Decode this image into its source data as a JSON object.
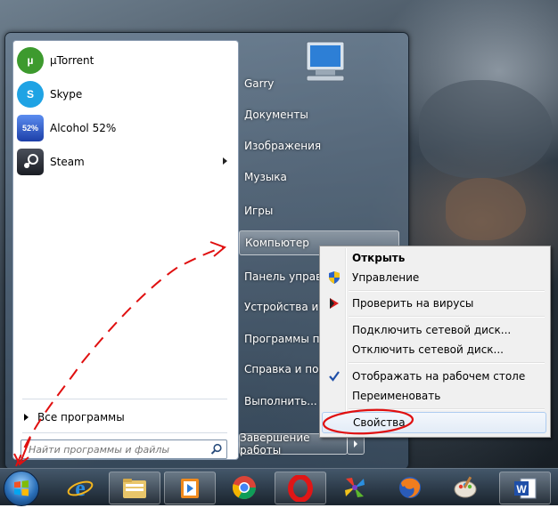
{
  "start_menu": {
    "pinned": [
      {
        "label": "µTorrent",
        "icon": "utorrent-icon",
        "color": "#3d9a2e"
      },
      {
        "label": "Skype",
        "icon": "skype-icon",
        "color": "#1fa3e4"
      },
      {
        "label": "Alcohol 52%",
        "icon": "alcohol-icon",
        "color": "#2b5bd1"
      },
      {
        "label": "Steam",
        "icon": "steam-icon",
        "color": "#2a2f3a",
        "has_submenu": true
      }
    ],
    "all_programs": "Все программы",
    "search": {
      "placeholder": "Найти программы и файлы"
    },
    "right_items": [
      {
        "label": "Garry"
      },
      {
        "label": "Документы"
      },
      {
        "label": "Изображения"
      },
      {
        "label": "Музыка"
      },
      {
        "label": "Игры"
      },
      {
        "label": "Компьютер",
        "highlighted": true
      },
      {
        "label": "Панель управле"
      },
      {
        "label": "Устройства и п"
      },
      {
        "label": "Программы по"
      },
      {
        "label": "Справка и подд"
      },
      {
        "label": "Выполнить..."
      }
    ],
    "shutdown": "Завершение работы"
  },
  "context_menu": {
    "items": [
      {
        "label": "Открыть",
        "bold": true
      },
      {
        "label": "Управление",
        "icon": "uac-shield-icon"
      },
      {
        "label": "Проверить на вирусы",
        "icon": "antivirus-icon"
      },
      {
        "label": "Подключить сетевой диск..."
      },
      {
        "label": "Отключить сетевой диск..."
      },
      {
        "label": "Отображать на рабочем столе",
        "icon": "checkmark-icon"
      },
      {
        "label": "Переименовать"
      },
      {
        "label": "Свойства",
        "highlighted": true
      }
    ]
  },
  "taskbar": {
    "apps": [
      "internet-explorer-icon",
      "explorer-folder-icon",
      "media-player-icon",
      "chrome-icon",
      "opera-icon",
      "pinwheel-app-icon",
      "firefox-icon",
      "paint-icon",
      "word-icon"
    ]
  },
  "colors": {
    "annotation": "#e01010",
    "highlight_border": "#aeccf0"
  }
}
